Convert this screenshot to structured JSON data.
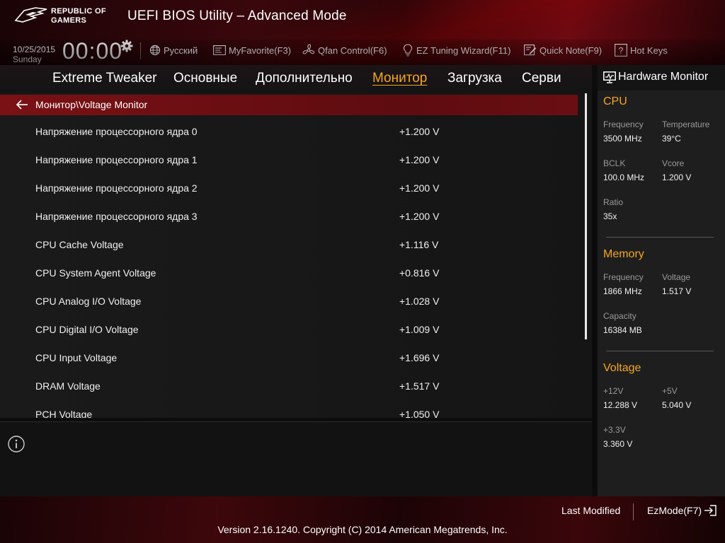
{
  "header": {
    "brand_line1": "REPUBLIC OF",
    "brand_line2": "GAMERS",
    "title": "UEFI BIOS Utility – Advanced Mode",
    "date": "10/25/2015",
    "day": "Sunday",
    "time": "00:00",
    "toolbar": {
      "language": "Русский",
      "myfavorite": "MyFavorite(F3)",
      "qfan": "Qfan Control(F6)",
      "ez_tuning": "EZ Tuning Wizard(F11)",
      "quick_note": "Quick Note(F9)",
      "hot_keys": "Hot Keys"
    }
  },
  "tabs": [
    {
      "label": "Extreme Tweaker",
      "active": false
    },
    {
      "label": "Основные",
      "active": false
    },
    {
      "label": "Дополнительно",
      "active": false
    },
    {
      "label": "Монитор",
      "active": true
    },
    {
      "label": "Загрузка",
      "active": false
    },
    {
      "label": "Сервис",
      "active": false
    }
  ],
  "breadcrumb": "Монитор\\Voltage Monitor",
  "voltages": [
    {
      "label": "Напряжение процессорного ядра 0",
      "value": "+1.200 V"
    },
    {
      "label": "Напряжение процессорного ядра 1",
      "value": "+1.200 V"
    },
    {
      "label": "Напряжение процессорного ядра 2",
      "value": "+1.200 V"
    },
    {
      "label": "Напряжение процессорного ядра 3",
      "value": "+1.200 V"
    },
    {
      "label": "CPU Cache Voltage",
      "value": "+1.116 V"
    },
    {
      "label": "CPU System Agent Voltage",
      "value": "+0.816 V"
    },
    {
      "label": "CPU Analog I/O Voltage",
      "value": "+1.028 V"
    },
    {
      "label": "CPU Digital I/O Voltage",
      "value": "+1.009 V"
    },
    {
      "label": "CPU Input Voltage",
      "value": "+1.696 V"
    },
    {
      "label": "DRAM Voltage",
      "value": "+1.517 V"
    },
    {
      "label": "PCH Voltage",
      "value": "+1.050 V"
    }
  ],
  "hw_monitor": {
    "title": "Hardware Monitor",
    "cpu": {
      "title": "CPU",
      "frequency_label": "Frequency",
      "frequency": "3500 MHz",
      "temperature_label": "Temperature",
      "temperature": "39°C",
      "bclk_label": "BCLK",
      "bclk": "100.0 MHz",
      "vcore_label": "Vcore",
      "vcore": "1.200 V",
      "ratio_label": "Ratio",
      "ratio": "35x"
    },
    "memory": {
      "title": "Memory",
      "frequency_label": "Frequency",
      "frequency": "1866 MHz",
      "voltage_label": "Voltage",
      "voltage": "1.517 V",
      "capacity_label": "Capacity",
      "capacity": "16384 MB"
    },
    "voltage": {
      "title": "Voltage",
      "v12_label": "+12V",
      "v12": "12.288 V",
      "v5_label": "+5V",
      "v5": "5.040 V",
      "v33_label": "+3.3V",
      "v33": "3.360 V"
    }
  },
  "footer": {
    "last_modified": "Last Modified",
    "ezmode": "EzMode(F7)",
    "copyright": "Version 2.16.1240. Copyright (C) 2014 American Megatrends, Inc."
  },
  "colors": {
    "accent": "#f5a623",
    "brand_red": "#7a1115"
  }
}
